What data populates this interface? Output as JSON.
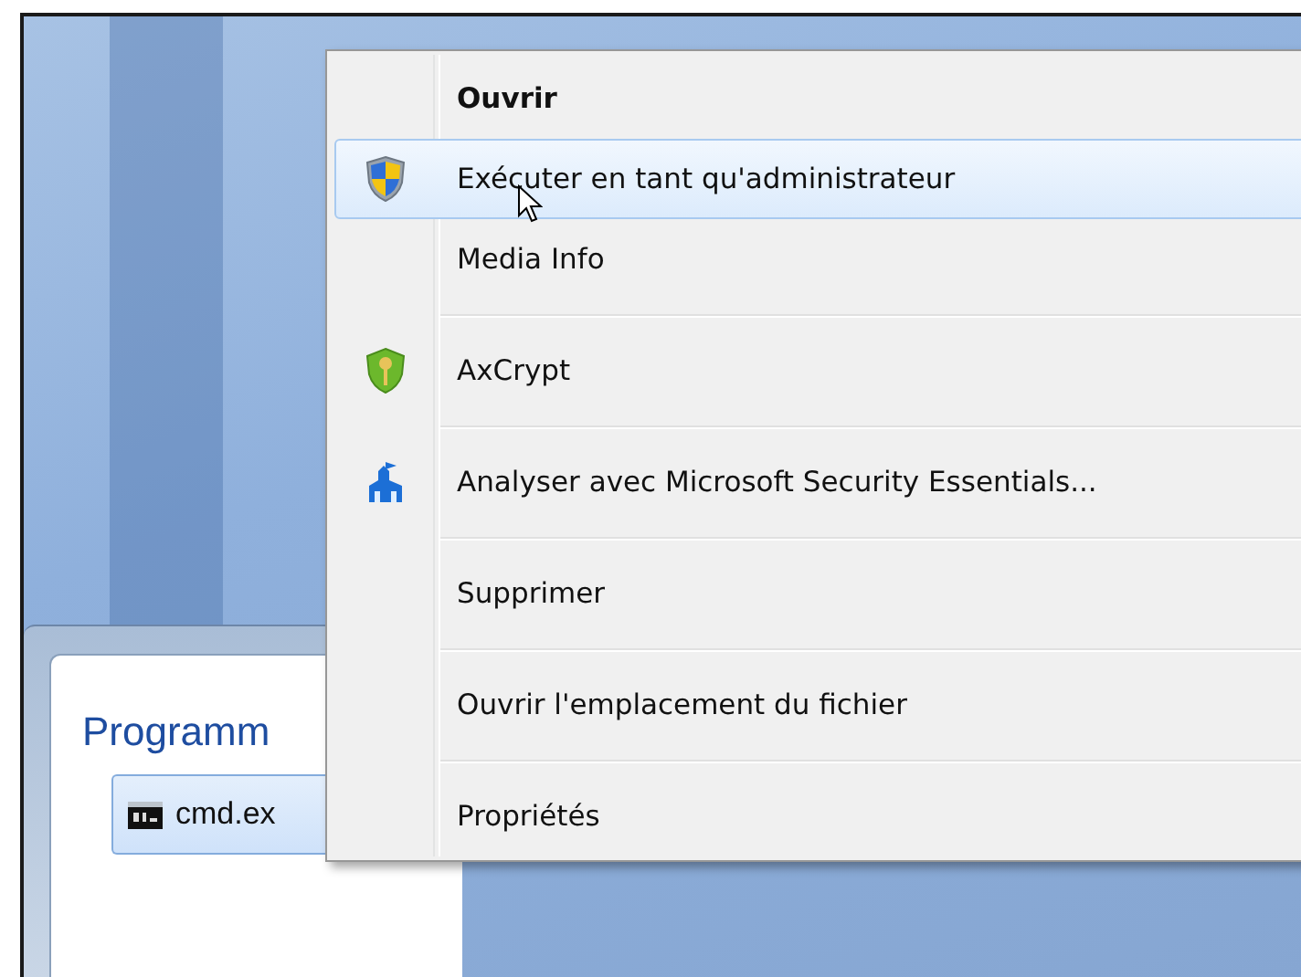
{
  "start_menu": {
    "section_title": "Programm",
    "results": [
      {
        "label": "cmd.ex",
        "selected": true
      }
    ]
  },
  "context_menu": {
    "groups": [
      [
        {
          "label": "Ouvrir",
          "default": true,
          "selected": false
        },
        {
          "label": "Exécuter en tant qu'administrateur",
          "default": false,
          "selected": true
        },
        {
          "label": "Media Info",
          "default": false,
          "selected": false
        }
      ],
      [
        {
          "label": "AxCrypt",
          "default": false,
          "selected": false
        }
      ],
      [
        {
          "label": "Analyser avec Microsoft Security Essentials...",
          "default": false,
          "selected": false
        }
      ],
      [
        {
          "label": "Supprimer",
          "default": false,
          "selected": false
        }
      ],
      [
        {
          "label": "Ouvrir l'emplacement du fichier",
          "default": false,
          "selected": false
        }
      ],
      [
        {
          "label": "Propriétés",
          "default": false,
          "selected": false
        }
      ]
    ]
  }
}
